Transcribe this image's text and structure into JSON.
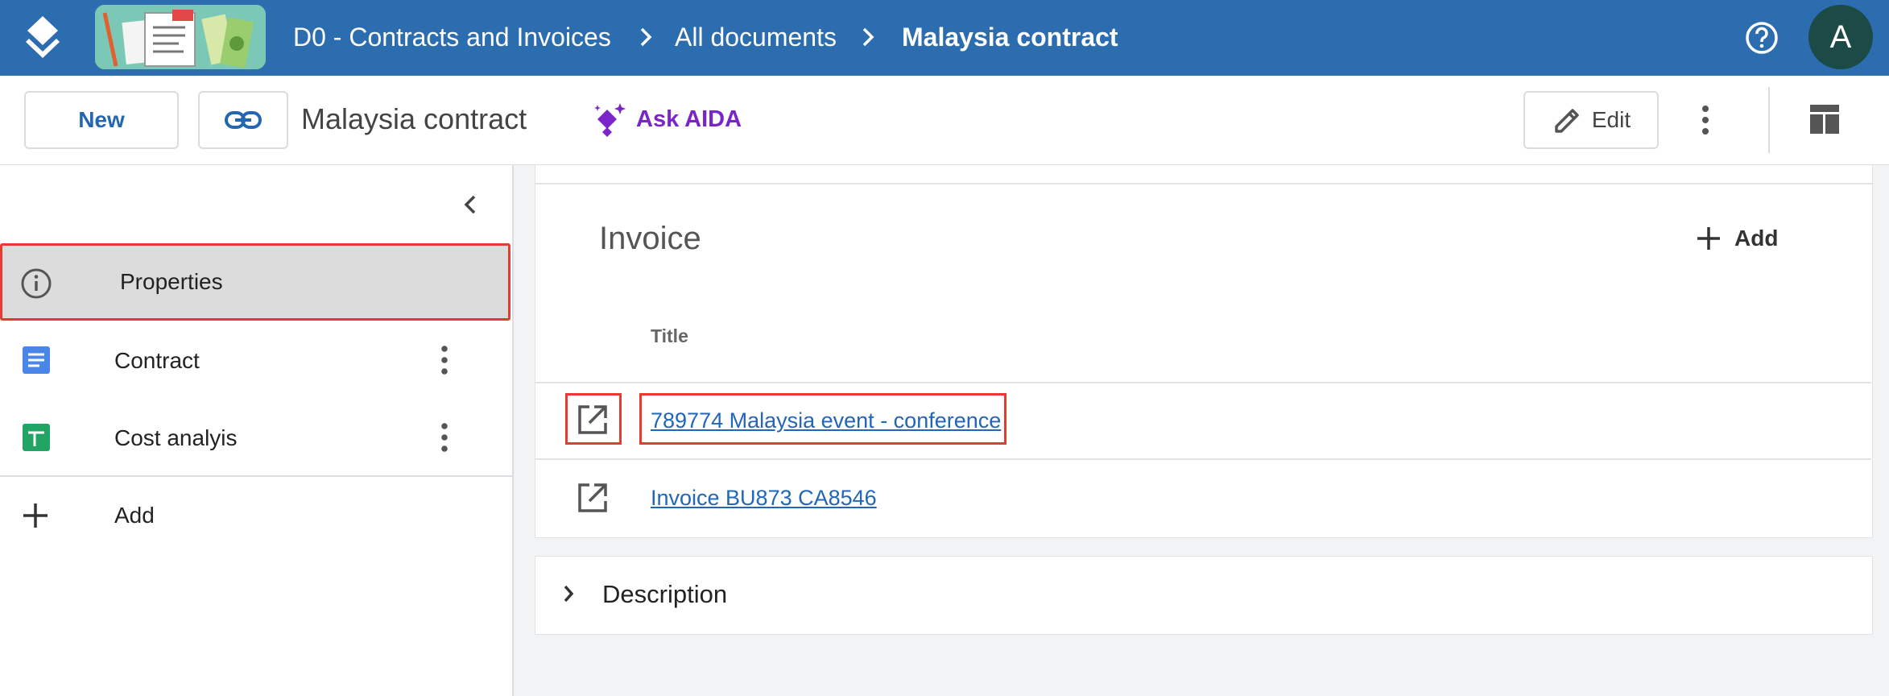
{
  "header": {
    "breadcrumbs": [
      "D0 - Contracts and Invoices",
      "All documents",
      "Malaysia contract"
    ],
    "avatar_letter": "A",
    "icons": {
      "logo": "layers-logo-icon",
      "help": "help-circle-icon",
      "separator": "chevron-right-icon"
    }
  },
  "toolbar": {
    "new_label": "New",
    "doc_title": "Malaysia contract",
    "ask_aida_label": "Ask AIDA",
    "edit_label": "Edit",
    "accent_color": "#7b24c9"
  },
  "sidebar": {
    "items": [
      {
        "label": "Properties",
        "icon": "info-icon",
        "selected": true
      },
      {
        "label": "Contract",
        "icon": "document-icon"
      },
      {
        "label": "Cost analyis",
        "icon": "spreadsheet-icon"
      }
    ],
    "add_label": "Add"
  },
  "main": {
    "invoice_section": {
      "title": "Invoice",
      "add_label": "Add",
      "column_header": "Title",
      "rows": [
        {
          "title": "789774 Malaysia event - conference",
          "highlighted": true
        },
        {
          "title": "Invoice BU873 CA8546",
          "highlighted": false
        }
      ]
    },
    "description_section": {
      "title": "Description"
    }
  },
  "colors": {
    "topbar": "#2c6db0",
    "link": "#2166b8",
    "highlight": "#e53b30",
    "avatar": "#1c4a46"
  }
}
